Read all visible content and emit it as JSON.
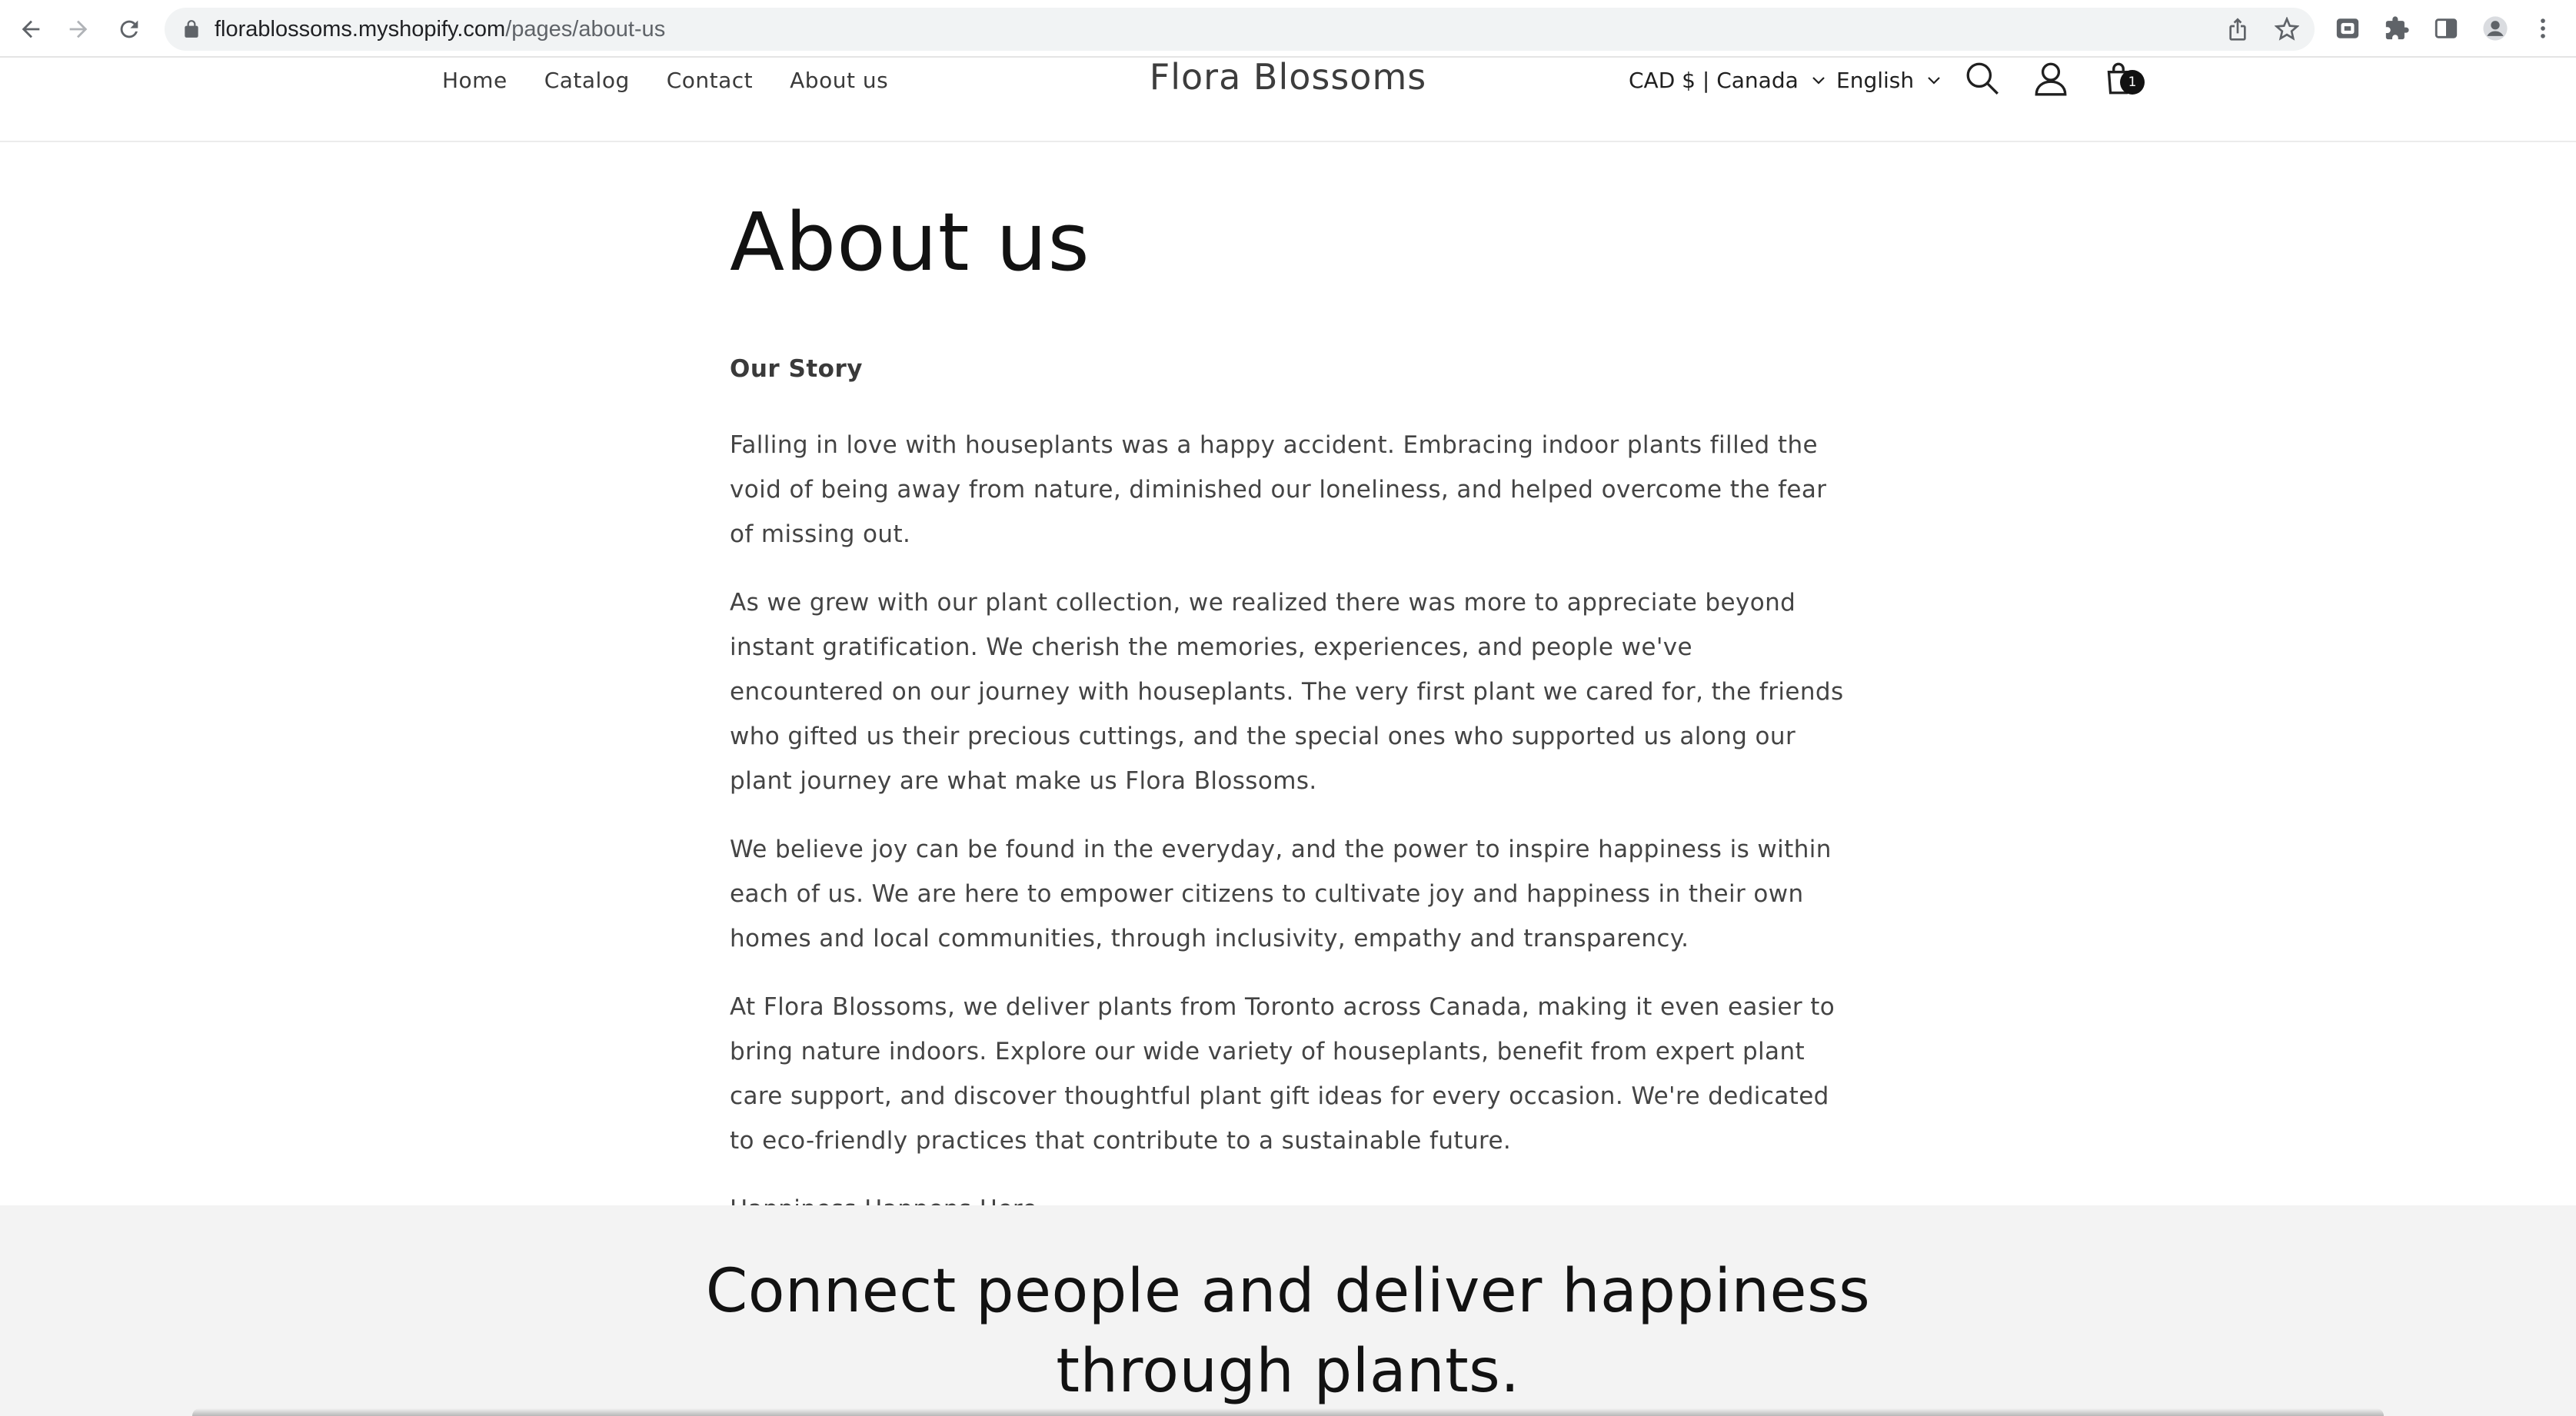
{
  "browser": {
    "url_host": "florablossoms.myshopify.com",
    "url_path": "/pages/about-us",
    "icons": [
      "back-arrow-icon",
      "forward-arrow-icon",
      "reload-icon",
      "lock-icon",
      "share-icon",
      "star-icon",
      "extension-icon",
      "puzzle-icon",
      "side-panel-icon",
      "profile-icon",
      "kebab-menu-icon"
    ]
  },
  "header": {
    "nav": [
      "Home",
      "Catalog",
      "Contact",
      "About us"
    ],
    "logo": "Flora Blossoms",
    "currency": "CAD $ | Canada",
    "language": "English",
    "cart_count": "1",
    "icons": [
      "search-icon",
      "account-icon",
      "cart-icon"
    ]
  },
  "page": {
    "title": "About us",
    "story_heading": "Our Story",
    "paragraphs": [
      "Falling in love with houseplants was a happy accident. Embracing indoor plants filled the void of being away from nature, diminished our loneliness, and helped overcome the fear of missing out.",
      "As we grew with our plant collection, we realized there was more to appreciate beyond instant gratification. We cherish the memories, experiences, and people we've encountered on our journey with houseplants. The very first plant we cared for, the friends who gifted us their precious cuttings, and the special ones who supported us along our plant journey are what make us Flora Blossoms.",
      "We believe joy can be found in the everyday, and the power to inspire happiness is within each of us. We are here to empower citizens to cultivate joy and happiness in their own homes and local communities, through inclusivity, empathy and transparency.",
      "At Flora Blossoms, we deliver plants from Toronto across Canada, making it even easier to bring nature indoors. Explore our wide variety of houseplants, benefit from expert plant care support, and discover thoughtful plant gift ideas for every occasion. We're dedicated to eco-friendly practices that contribute to a sustainable future.",
      "Happiness Happens Here."
    ]
  },
  "banner": {
    "heading": "Connect people and deliver happiness through plants."
  },
  "colors": {
    "text": "#121212",
    "body_text": "#444444",
    "banner_bg": "#f3f3f3",
    "omnibox_bg": "#f1f3f4"
  }
}
